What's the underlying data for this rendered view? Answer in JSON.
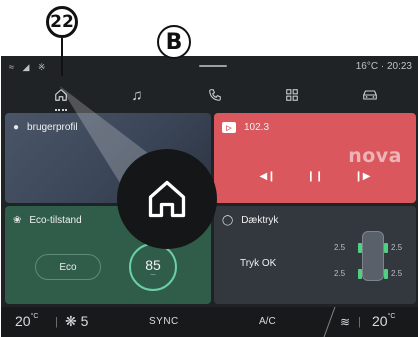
{
  "callouts": {
    "number": "22",
    "letter": "B"
  },
  "status_bar": {
    "icons": [
      "wifi-icon",
      "signal-icon",
      "bluetooth-icon"
    ],
    "temperature": "16°C",
    "time": "20:23"
  },
  "nav": {
    "items": [
      {
        "icon": "home-icon",
        "active": true
      },
      {
        "icon": "music-icon"
      },
      {
        "icon": "phone-icon"
      },
      {
        "icon": "apps-grid-icon"
      },
      {
        "icon": "car-icon"
      }
    ]
  },
  "tiles": {
    "profile": {
      "label": "brugerprofil"
    },
    "radio": {
      "frequency": "102.3",
      "station_logo": "nova"
    },
    "eco": {
      "label": "Eco-tilstand",
      "mode": "Eco",
      "score": "85"
    },
    "tyre": {
      "label": "Dæktryk",
      "status": "Tryk OK",
      "front_left": "2.5",
      "front_right": "2.5",
      "rear_left": "2.5",
      "rear_right": "2.5"
    }
  },
  "bottom_bar": {
    "temp_left": "20",
    "temp_left_unit": "°C",
    "fan_level": "5",
    "sync_label": "SYNC",
    "ac_label": "A/C",
    "temp_right": "20",
    "temp_right_unit": "°C"
  },
  "colors": {
    "radio_tile": "#d9575d",
    "eco_tile": "#2f5d4a",
    "tyre_ok": "#4fd17f",
    "eco_ring": "#6bcfa8"
  }
}
